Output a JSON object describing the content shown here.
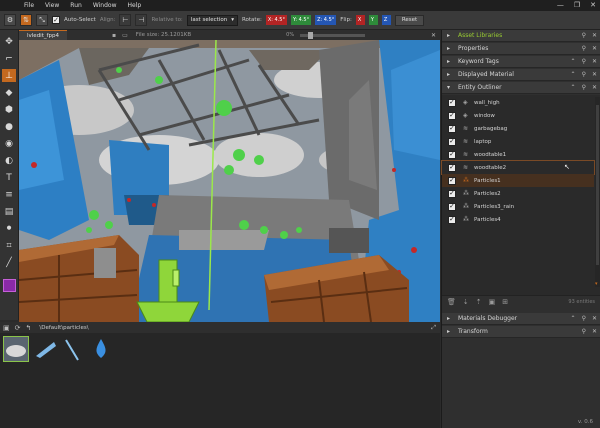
{
  "menu": [
    "File",
    "View",
    "Run",
    "Window",
    "Help"
  ],
  "toolbar": {
    "auto_select_label": "Auto-Select",
    "align_label": "Align:",
    "relative_to_label": "Relative to:",
    "relative_to_value": "last selection",
    "rotate_label": "Rotate:",
    "rotate_x": "X: 4.5°",
    "rotate_y": "Y: 4.5°",
    "rotate_z": "Z: 4.5°",
    "flip_label": "Flip:",
    "flip_x": "X",
    "flip_y": "Y",
    "flip_z": "Z",
    "reset_label": "Reset"
  },
  "viewport": {
    "tab_label": "lvledit_fpp4",
    "file_size": "File size: 25.1201KB",
    "zoom_pct": "0%"
  },
  "assets": {
    "path": "\\Default\\particles\\"
  },
  "right_panel": {
    "sections_top": [
      "Asset Libraries",
      "Properties",
      "Keyword Tags",
      "Displayed Material",
      "Entity Outliner"
    ],
    "sections_bottom": [
      "Materials Debugger",
      "Transform"
    ],
    "entities": [
      {
        "name": "wall_high",
        "checked": true
      },
      {
        "name": "window",
        "checked": true
      },
      {
        "name": "garbagebag",
        "checked": true
      },
      {
        "name": "laptop",
        "checked": true
      },
      {
        "name": "woodtable1",
        "checked": true
      },
      {
        "name": "woodtable2",
        "checked": true
      },
      {
        "name": "Particles1",
        "checked": true
      },
      {
        "name": "Particles2",
        "checked": true
      },
      {
        "name": "Particles3_rain",
        "checked": true
      },
      {
        "name": "Particles4",
        "checked": true
      }
    ],
    "entity_count": "93 entities"
  },
  "version": "v. 0.6",
  "colors": {
    "accent": "#c4691f",
    "highlight_green": "#9acd32",
    "rotate_x": "#b32424",
    "rotate_y": "#2e8b3a",
    "rotate_z": "#2456b3"
  }
}
